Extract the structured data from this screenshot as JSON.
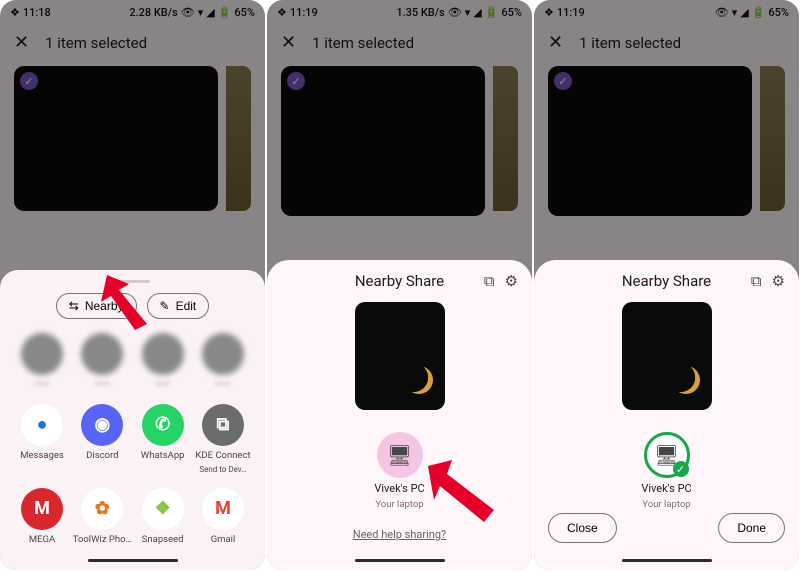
{
  "status": {
    "time1": "11:18",
    "time2": "11:19",
    "time3": "11:19",
    "net1": "2.28 KB/s",
    "net2": "1.35 KB/s",
    "battery": "65%"
  },
  "header": {
    "title": "1 item selected"
  },
  "sheet1": {
    "nearby": "Nearby",
    "edit": "Edit",
    "apps1": [
      {
        "name": "Messages",
        "color": "#fff",
        "fg": "#1a73e8",
        "glyph": "●"
      },
      {
        "name": "Discord",
        "color": "#5865F2",
        "glyph": "◉"
      },
      {
        "name": "WhatsApp",
        "color": "#25D366",
        "glyph": "✆"
      },
      {
        "name": "KDE Connect",
        "sub": "Send to Dev…",
        "color": "#6c6c6c",
        "glyph": "⧉"
      }
    ],
    "apps2": [
      {
        "name": "MEGA",
        "color": "#d9272e",
        "glyph": "M"
      },
      {
        "name": "ToolWiz Pho…",
        "color": "#fff",
        "fg": "#e87722",
        "glyph": "✿"
      },
      {
        "name": "Snapseed",
        "color": "#fff",
        "fg": "#8bc34a",
        "glyph": "❖"
      },
      {
        "name": "Gmail",
        "color": "#fff",
        "fg": "#ea4335",
        "glyph": "M"
      }
    ]
  },
  "nearby": {
    "title": "Nearby Share",
    "device": "Vivek's PC",
    "deviceType": "Your laptop",
    "help": "Need help sharing?",
    "close": "Close",
    "done": "Done"
  }
}
